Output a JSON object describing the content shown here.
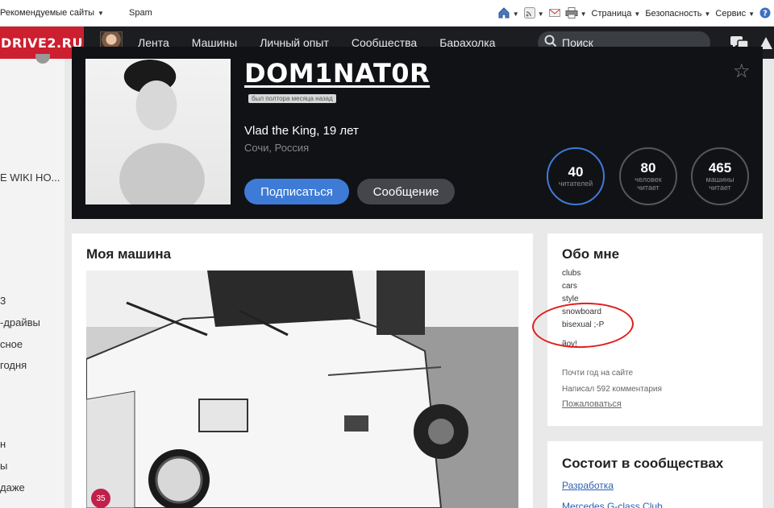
{
  "ie_toolbar": {
    "favorites": [
      {
        "label": "Рекомендуемые сайты"
      },
      {
        "label": "Spam"
      }
    ],
    "page_menu": "Страница",
    "security_menu": "Безопасность",
    "service_menu": "Сервис"
  },
  "nav": {
    "logo": "DRIVE2.RU",
    "links": [
      "Лента",
      "Машины",
      "Личный опыт",
      "Сообщества",
      "Барахолка"
    ],
    "search_placeholder": "Поиск"
  },
  "left_column": {
    "items": [
      "E WIKI HO...",
      "3",
      "-драйвы",
      "сное",
      "годня",
      "н",
      "ы",
      "даже"
    ]
  },
  "profile": {
    "username": "DOM1NAT0R",
    "last_seen": "был полтора месяца назад",
    "name_age": "Vlad the King, 19 лет",
    "location": "Сочи, Россия",
    "subscribe_label": "Подписаться",
    "message_label": "Сообщение",
    "stats": [
      {
        "value": "40",
        "label": "читателей"
      },
      {
        "value": "80",
        "label": "человек читает"
      },
      {
        "value": "465",
        "label": "машины читает"
      }
    ]
  },
  "car": {
    "title": "Моя машина",
    "photo_count": "35"
  },
  "about": {
    "title": "Обо мне",
    "tags": [
      "clubs",
      "cars",
      "style",
      "snowboard",
      "bisexual ;-P",
      "йоу!"
    ],
    "since": "Почти год на сайте",
    "comments": "Написал 592 комментария",
    "report": "Пожаловаться"
  },
  "communities": {
    "title": "Состоит в сообществах",
    "links": [
      "Разработка",
      "Mercedes G-class Club"
    ]
  },
  "colors": {
    "brand": "#cc1f2f",
    "accent": "#3d7bd6",
    "annotation": "#e21d1d"
  }
}
